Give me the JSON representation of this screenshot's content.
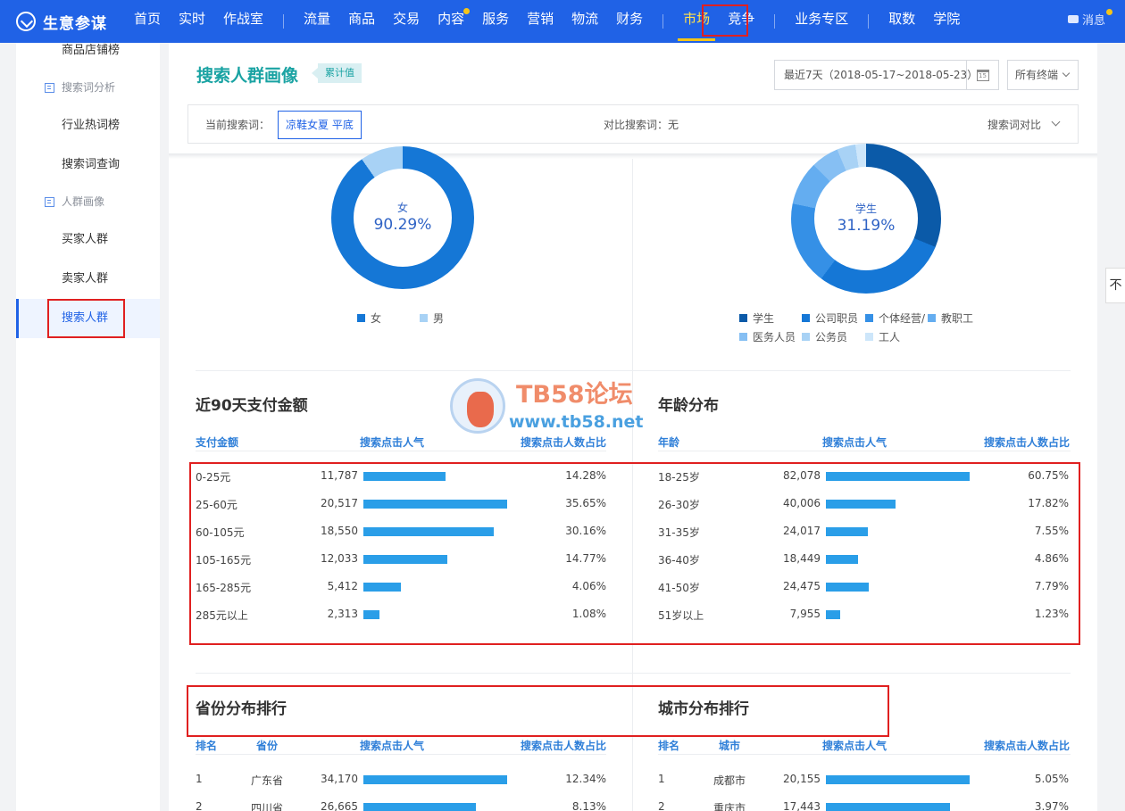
{
  "brand": {
    "name": "生意参谋",
    "logo_icon": "compass-icon"
  },
  "nav": {
    "items": [
      "首页",
      "实时",
      "作战室",
      "流量",
      "商品",
      "交易",
      "内容",
      "服务",
      "营销",
      "物流",
      "财务",
      "市场",
      "竞争",
      "业务专区",
      "取数",
      "学院"
    ],
    "active": "市场",
    "message": "消息"
  },
  "sidebar": {
    "items": [
      {
        "label": "商品店铺榜",
        "type": "item"
      },
      {
        "label": "搜索词分析",
        "type": "group"
      },
      {
        "label": "行业热词榜",
        "type": "item"
      },
      {
        "label": "搜索词查询",
        "type": "item"
      },
      {
        "label": "人群画像",
        "type": "group"
      },
      {
        "label": "买家人群",
        "type": "item"
      },
      {
        "label": "卖家人群",
        "type": "item"
      },
      {
        "label": "搜索人群",
        "type": "item",
        "active": true
      }
    ]
  },
  "header": {
    "title": "搜索人群画像",
    "tag": "累计值",
    "date_range": "最近7天（2018-05-17~2018-05-23）",
    "calendar_day": "15",
    "terminal": "所有终端",
    "current_keyword_label": "当前搜索词：",
    "current_keyword": "凉鞋女夏 平底",
    "compare_label": "对比搜索词：无",
    "compare_button": "搜索词对比"
  },
  "gender": {
    "center_label": "女",
    "center_value": "90.29%",
    "slices": [
      {
        "name": "女",
        "percent": 90.29,
        "color": "#1577d6"
      },
      {
        "name": "男",
        "percent": 9.71,
        "color": "#a8d2f5"
      }
    ]
  },
  "occupation": {
    "center_label": "学生",
    "center_value": "31.19%",
    "slices": [
      {
        "name": "学生",
        "percent": 31.19,
        "color": "#0b5aa8"
      },
      {
        "name": "公司职员",
        "percent": 29.0,
        "color": "#1577d6"
      },
      {
        "name": "个体经营/",
        "percent": 18.0,
        "color": "#3590e6"
      },
      {
        "name": "教职工",
        "percent": 9.5,
        "color": "#64adf0"
      },
      {
        "name": "医务人员",
        "percent": 6.0,
        "color": "#86bff3"
      },
      {
        "name": "公务员",
        "percent": 4.0,
        "color": "#a8d2f5"
      },
      {
        "name": "工人",
        "percent": 2.31,
        "color": "#cde6fa"
      }
    ]
  },
  "payment": {
    "title": "近90天支付金额",
    "headers": [
      "支付金额",
      "搜索点击人气",
      "搜索点击人数占比"
    ],
    "max_value": 20517,
    "rows": [
      {
        "label": "0-25元",
        "value": "11,787",
        "raw": 11787,
        "pct": "14.28%"
      },
      {
        "label": "25-60元",
        "value": "20,517",
        "raw": 20517,
        "pct": "35.65%"
      },
      {
        "label": "60-105元",
        "value": "18,550",
        "raw": 18550,
        "pct": "30.16%"
      },
      {
        "label": "105-165元",
        "value": "12,033",
        "raw": 12033,
        "pct": "14.77%"
      },
      {
        "label": "165-285元",
        "value": "5,412",
        "raw": 5412,
        "pct": "4.06%"
      },
      {
        "label": "285元以上",
        "value": "2,313",
        "raw": 2313,
        "pct": "1.08%"
      }
    ]
  },
  "age": {
    "title": "年龄分布",
    "headers": [
      "年龄",
      "搜索点击人气",
      "搜索点击人数占比"
    ],
    "max_value": 82078,
    "rows": [
      {
        "label": "18-25岁",
        "value": "82,078",
        "raw": 82078,
        "pct": "60.75%"
      },
      {
        "label": "26-30岁",
        "value": "40,006",
        "raw": 40006,
        "pct": "17.82%"
      },
      {
        "label": "31-35岁",
        "value": "24,017",
        "raw": 24017,
        "pct": "7.55%"
      },
      {
        "label": "36-40岁",
        "value": "18,449",
        "raw": 18449,
        "pct": "4.86%"
      },
      {
        "label": "41-50岁",
        "value": "24,475",
        "raw": 24475,
        "pct": "7.79%"
      },
      {
        "label": "51岁以上",
        "value": "7,955",
        "raw": 7955,
        "pct": "1.23%"
      }
    ]
  },
  "province": {
    "title": "省份分布排行",
    "headers": [
      "排名",
      "省份",
      "搜索点击人气",
      "搜索点击人数占比"
    ],
    "max_value": 34170,
    "rows": [
      {
        "rank": "1",
        "name": "广东省",
        "value": "34,170",
        "raw": 34170,
        "pct": "12.34%"
      },
      {
        "rank": "2",
        "name": "四川省",
        "value": "26,665",
        "raw": 26665,
        "pct": "8.13%"
      }
    ]
  },
  "city": {
    "title": "城市分布排行",
    "headers": [
      "排名",
      "城市",
      "搜索点击人气",
      "搜索点击人数占比"
    ],
    "max_value": 20155,
    "rows": [
      {
        "rank": "1",
        "name": "成都市",
        "value": "20,155",
        "raw": 20155,
        "pct": "5.05%"
      },
      {
        "rank": "2",
        "name": "重庆市",
        "value": "17,443",
        "raw": 17443,
        "pct": "3.97%"
      }
    ]
  },
  "watermark": {
    "line1": "TB58论坛",
    "line2": "www.tb58.net"
  },
  "float_button": "不",
  "colors": {
    "nav_bg": "#2062e6",
    "bar": "#2a9ee8",
    "teal_title": "#1aa3a3",
    "highlight": "#e02020"
  }
}
